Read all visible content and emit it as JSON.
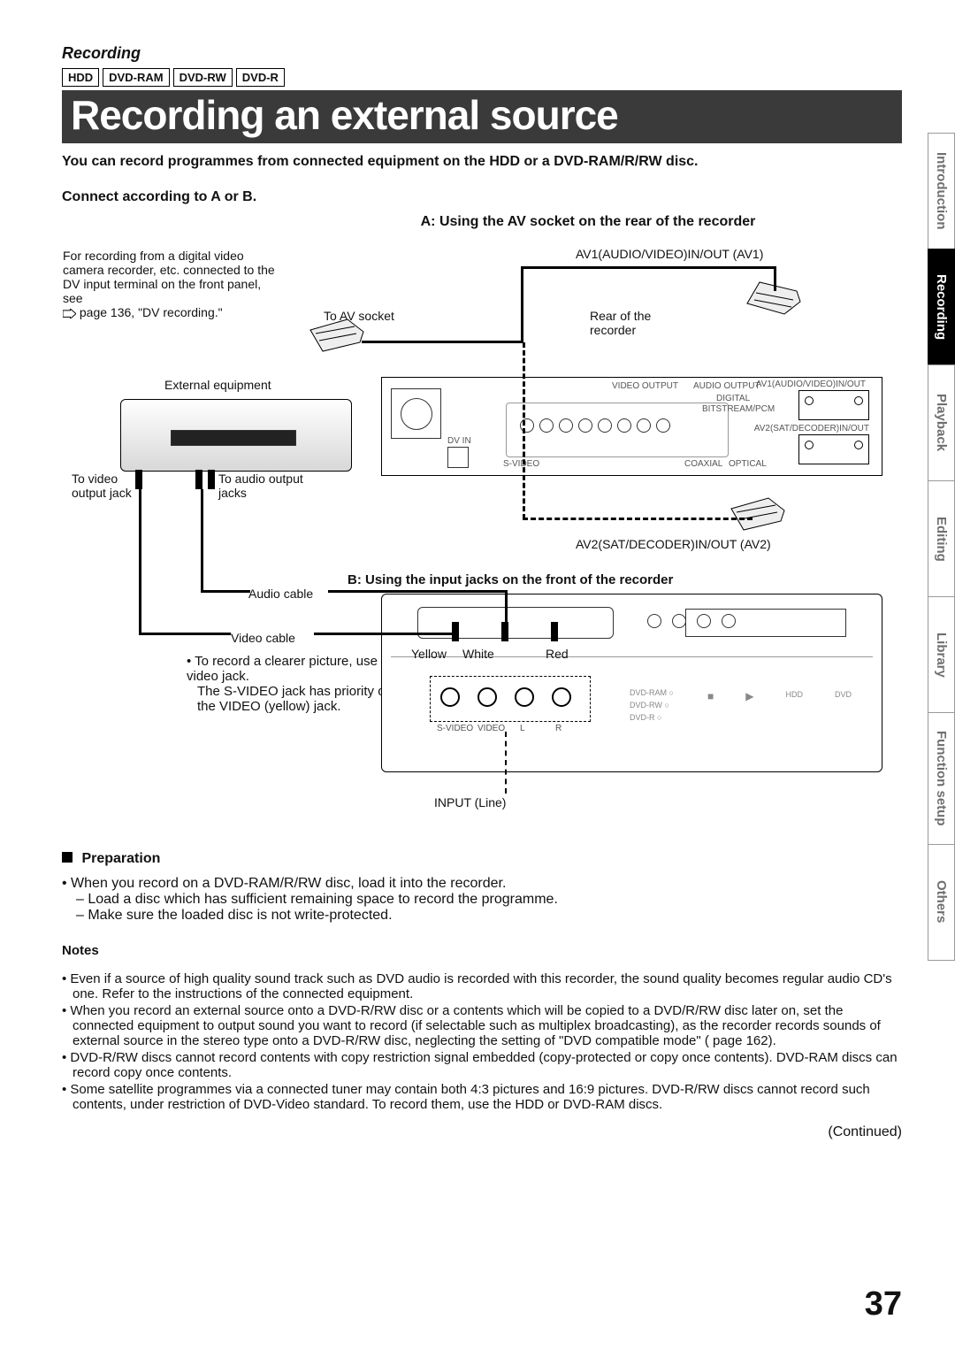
{
  "header": {
    "section": "Recording",
    "media": [
      "HDD",
      "DVD-RAM",
      "DVD-RW",
      "DVD-R"
    ],
    "title": "Recording an external source"
  },
  "lead": "You can record programmes from connected equipment on the HDD or a DVD-RAM/R/RW disc.",
  "connect_heading": "Connect according to A or B.",
  "optionA": {
    "title": "A: Using the AV socket on the rear of the recorder",
    "dv_note": "For recording from a digital video camera recorder, etc. connected to the DV input terminal on the front panel, see",
    "dv_ref": "page 136, \"DV recording.\"",
    "labels": {
      "av1": "AV1(AUDIO/VIDEO)IN/OUT (AV1)",
      "rear": "Rear of the recorder",
      "to_av": "To AV socket",
      "ext": "External equipment",
      "to_video": "To video output jack",
      "to_audio": "To audio output jacks",
      "av2": "AV2(SAT/DECODER)IN/OUT (AV2)"
    }
  },
  "optionB": {
    "title": "B: Using the input jacks on the front of the recorder",
    "audio_cable": "Audio cable",
    "video_cable": "Video cable",
    "jack_note1": "• To record a clearer picture, use the S video jack.",
    "jack_note2": "The S-VIDEO jack has priority over the VIDEO (yellow) jack.",
    "colors": {
      "yellow": "Yellow",
      "white": "White",
      "red": "Red"
    },
    "input_label": "INPUT (Line)"
  },
  "preparation": {
    "heading": "Preparation",
    "items": [
      "• When you record on a DVD-RAM/R/RW disc, load it into the recorder.",
      "– Load a disc which has sufficient remaining space to record the programme.",
      "– Make sure the loaded disc is not write-protected."
    ]
  },
  "notes": {
    "heading": "Notes",
    "items": [
      "• Even if a source of high quality sound track such as DVD audio is recorded with this recorder, the sound quality becomes regular audio CD's one. Refer to the instructions of the connected equipment.",
      "• When you record an external source onto a DVD-R/RW disc or a contents which will be copied to a DVD/R/RW disc later on, set the connected equipment to output sound you want to record (if selectable such as multiplex broadcasting), as the recorder records sounds of external source in the stereo type onto a DVD-R/RW disc, neglecting the setting of \"DVD compatible mode\" (      page 162).",
      "• DVD-R/RW discs cannot record contents with copy restriction signal embedded (copy-protected or copy once contents). DVD-RAM discs can record copy once contents.",
      "• Some satellite programmes via a connected tuner may contain both 4:3 pictures and 16:9 pictures. DVD-R/RW discs cannot record such contents, under restriction of DVD-Video standard. To record them, use the HDD or DVD-RAM discs."
    ]
  },
  "continued": "(Continued)",
  "page_number": "37",
  "tabs": [
    "Introduction",
    "Recording",
    "Playback",
    "Editing",
    "Library",
    "Function setup",
    "Others"
  ],
  "active_tab": "Recording",
  "panel_tiny": {
    "av1": "AV1(AUDIO/VIDEO)IN/OUT",
    "av2": "AV2(SAT/DECODER)IN/OUT",
    "vout": "VIDEO OUTPUT",
    "aout": "AUDIO OUTPUT",
    "digital": "DIGITAL",
    "bitstream": "BITSTREAM/PCM",
    "coax": "COAXIAL",
    "opt": "OPTICAL",
    "dvin": "DV IN",
    "svideo": "S-VIDEO",
    "video": "VIDEO",
    "l": "L",
    "r": "R"
  }
}
